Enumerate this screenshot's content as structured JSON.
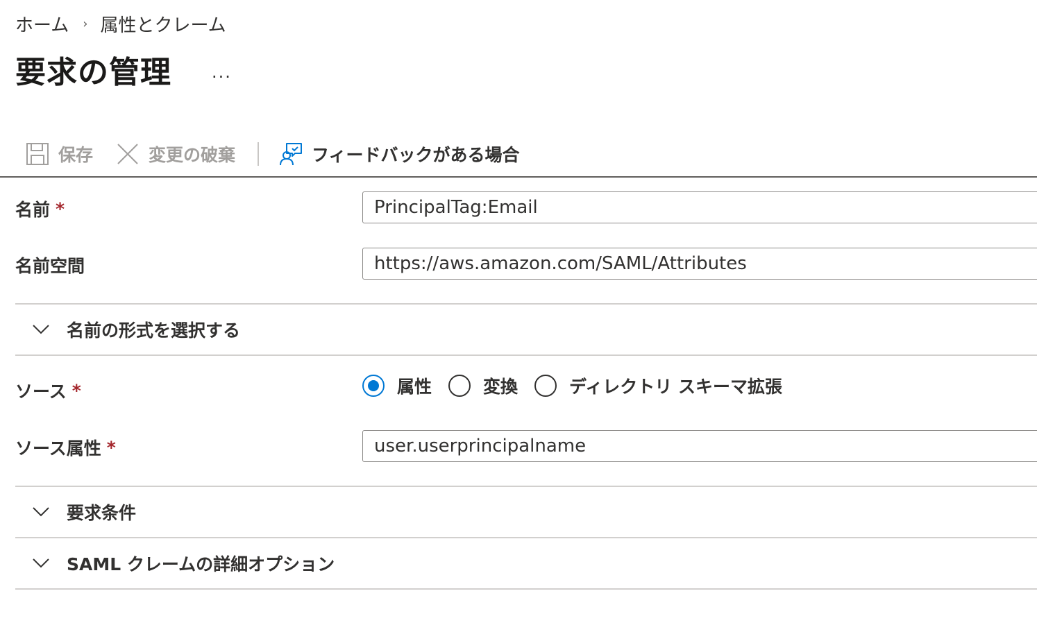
{
  "breadcrumb": {
    "items": [
      "ホーム",
      "属性とクレーム"
    ],
    "separator": "›"
  },
  "header": {
    "title": "要求の管理",
    "more_label": "..."
  },
  "toolbar": {
    "save_label": "保存",
    "discard_label": "変更の破棄",
    "feedback_label": "フィードバックがある場合",
    "save_enabled": false,
    "discard_enabled": false
  },
  "form": {
    "name": {
      "label": "名前",
      "required_mark": "*",
      "value": "PrincipalTag:Email"
    },
    "namespace": {
      "label": "名前空間",
      "value": "https://aws.amazon.com/SAML/Attributes"
    },
    "name_format_section": {
      "label": "名前の形式を選択する"
    },
    "source": {
      "label": "ソース",
      "required_mark": "*",
      "options": [
        "属性",
        "変換",
        "ディレクトリ スキーマ拡張"
      ],
      "selected": "属性"
    },
    "source_attribute": {
      "label": "ソース属性",
      "required_mark": "*",
      "value": "user.userprincipalname"
    },
    "claim_conditions_section": {
      "label": "要求条件"
    },
    "saml_advanced_section": {
      "label": "SAML クレームの詳細オプション"
    }
  },
  "colors": {
    "accent": "#0078d4",
    "required": "#a4262c",
    "disabled_text": "#a19f9d",
    "text": "#323130",
    "divider": "#d2d0ce"
  },
  "icons": {
    "save": "save-icon",
    "discard": "close-icon",
    "feedback": "feedback-icon",
    "chevron": "chevron-down-icon"
  }
}
